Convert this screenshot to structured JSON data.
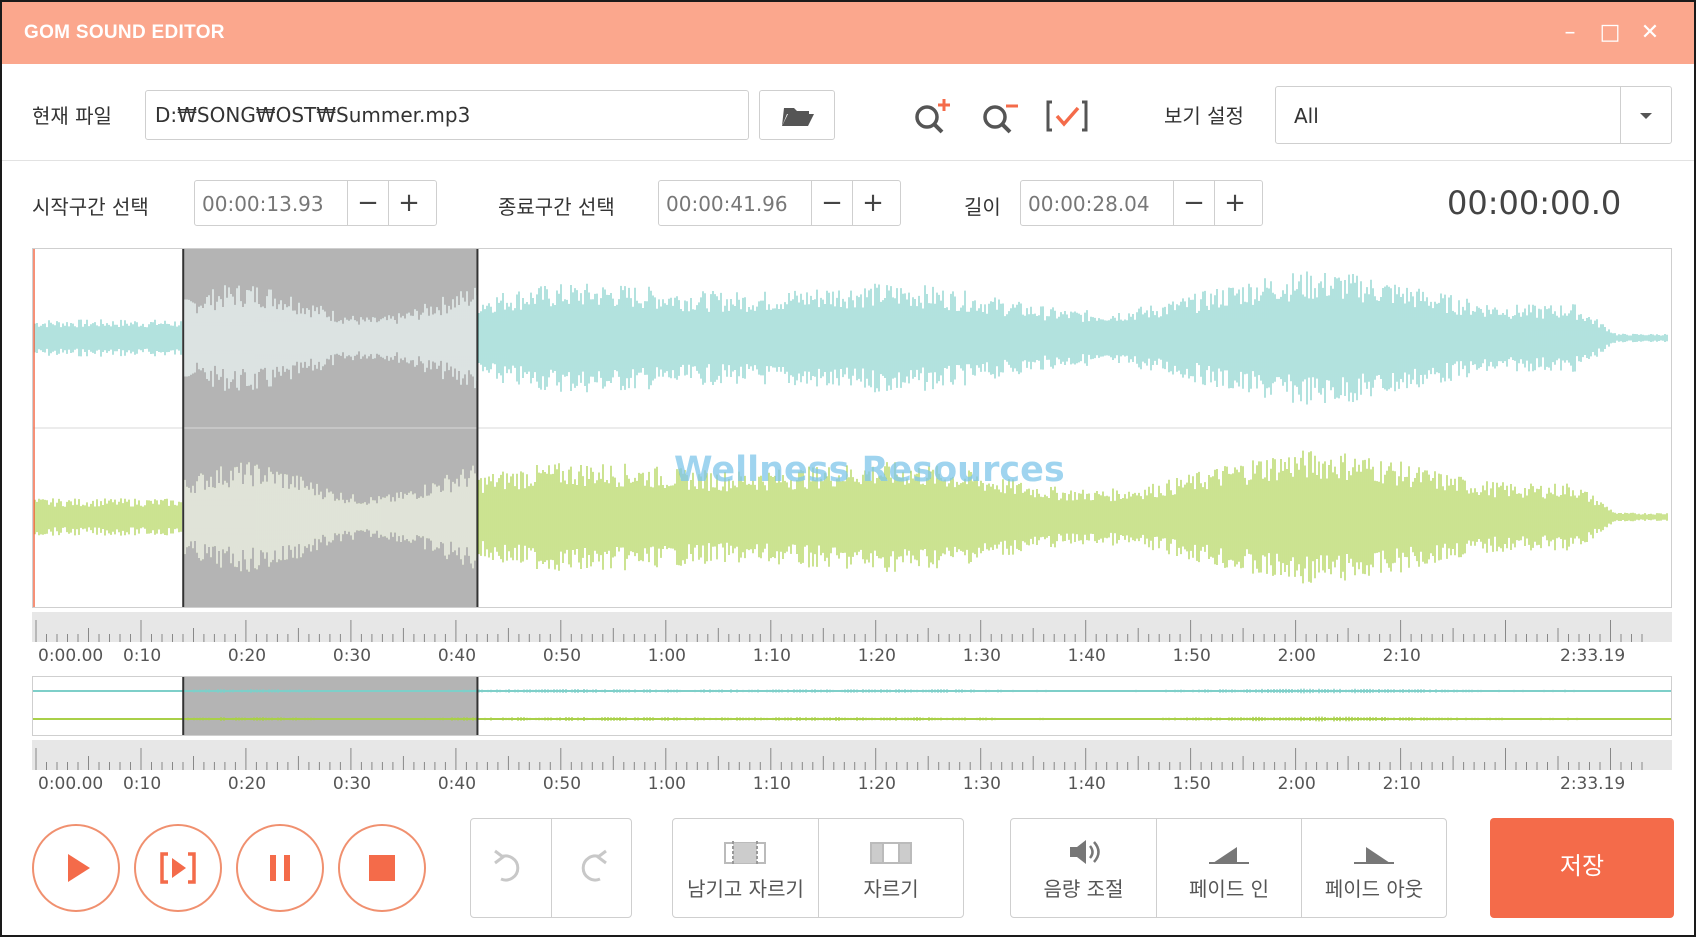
{
  "window": {
    "title": "GOM SOUND EDITOR",
    "controls": [
      "–",
      "□",
      "✕"
    ]
  },
  "file": {
    "label": "현재 파일",
    "path": "D:₩SONG₩OST₩Summer.mp3",
    "open_icon": "folder-open-icon"
  },
  "toolbar": {
    "zoom_in_icon": "zoom-in-icon",
    "zoom_out_icon": "zoom-out-icon",
    "fit_icon": "select-check-icon",
    "view_label": "보기 설정",
    "view_value": "All"
  },
  "selection": {
    "start_label": "시작구간 선택",
    "start_value": "00:00:13.93",
    "end_label": "종료구간 선택",
    "end_value": "00:00:41.96",
    "length_label": "길이",
    "length_value": "00:00:28.04",
    "minus": "−",
    "plus": "+"
  },
  "current_time": "00:00:00.0",
  "timeline": {
    "labels": [
      "0:00.00",
      "0:10",
      "0:20",
      "0:30",
      "0:40",
      "0:50",
      "1:00",
      "1:10",
      "1:20",
      "1:30",
      "1:40",
      "1:50",
      "2:00",
      "2:10",
      "2:33.19"
    ],
    "duration_seconds": 153.19,
    "selection_start_seconds": 13.93,
    "selection_end_seconds": 41.96
  },
  "colors": {
    "titlebar": "#fba78d",
    "accent": "#f46b4a",
    "channel_left": "#7ecfc9",
    "channel_right": "#a9d048",
    "selection": "#b4b4b4"
  },
  "playback": {
    "play_icon": "play-icon",
    "play_selection_icon": "play-selection-icon",
    "pause_icon": "pause-icon",
    "stop_icon": "stop-icon"
  },
  "history": {
    "undo_icon": "undo-icon",
    "redo_icon": "redo-icon"
  },
  "edit": {
    "trim_label": "남기고 자르기",
    "cut_label": "자르기"
  },
  "effects": {
    "volume_label": "음량 조절",
    "fade_in_label": "페이드 인",
    "fade_out_label": "페이드 아웃"
  },
  "save_label": "저장",
  "watermark": "Wellness Resources"
}
